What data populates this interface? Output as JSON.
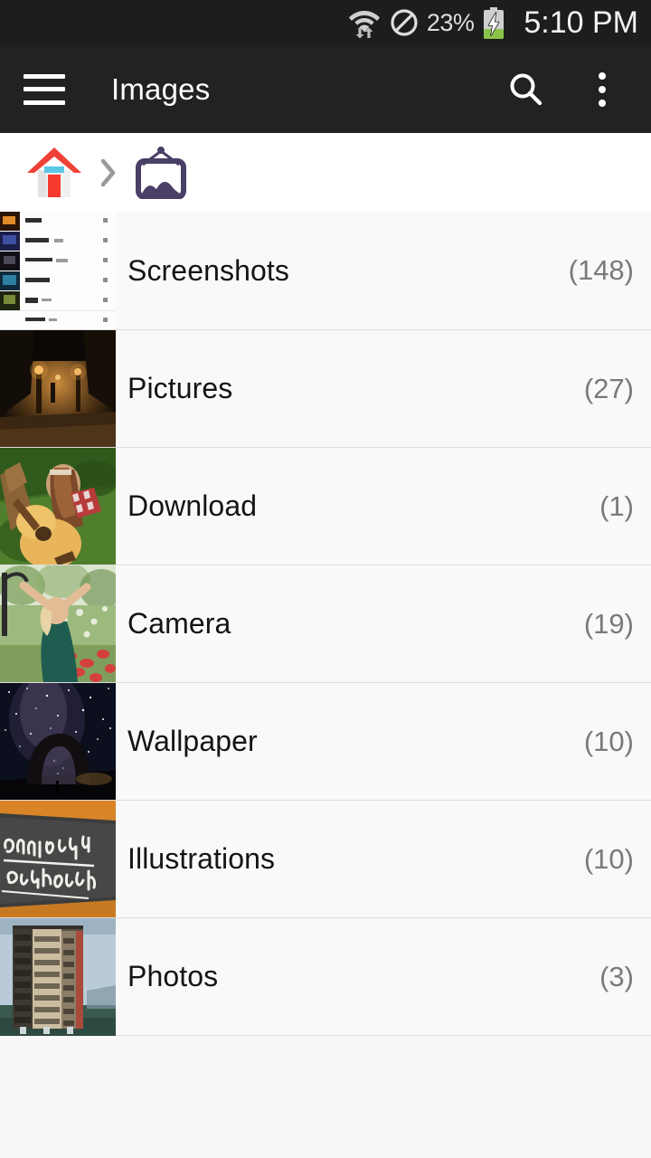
{
  "status_bar": {
    "wifi_icon": "wifi-with-data-arrows-icon",
    "block_icon": "do-not-disturb-icon",
    "battery_percent": "23%",
    "battery_icon": "battery-charging-icon",
    "time": "5:10 PM"
  },
  "app_bar": {
    "menu_icon": "hamburger-menu-icon",
    "title": "Images",
    "search_icon": "search-icon",
    "overflow_icon": "more-options-icon"
  },
  "breadcrumb": {
    "items": [
      {
        "name": "home-crumb",
        "icon": "home-icon"
      },
      {
        "name": "images-crumb",
        "icon": "picture-frame-icon"
      }
    ],
    "separator_icon": "chevron-right-icon"
  },
  "folders": [
    {
      "name": "Screenshots",
      "count": "(148)",
      "thumb": "screenshot-list-thumbnail"
    },
    {
      "name": "Pictures",
      "count": "(27)",
      "thumb": "night-street-thumbnail"
    },
    {
      "name": "Download",
      "count": "(1)",
      "thumb": "guitar-girl-thumbnail"
    },
    {
      "name": "Camera",
      "count": "(19)",
      "thumb": "woman-in-flower-field-thumbnail"
    },
    {
      "name": "Wallpaper",
      "count": "(10)",
      "thumb": "milky-way-arch-thumbnail"
    },
    {
      "name": "Illustrations",
      "count": "(10)",
      "thumb": "chalkboard-learning-thumbnail"
    },
    {
      "name": "Photos",
      "count": "(3)",
      "thumb": "apartment-building-thumbnail"
    }
  ],
  "colors": {
    "status_bar_bg": "#1d1d1d",
    "app_bar_bg": "#222222",
    "breadcrumb_bg": "#ffffff",
    "list_bg": "#f9f9f9",
    "page_bg": "#f8f8f8",
    "divider": "#dddddd",
    "title_text": "#ffffff",
    "folder_text": "#141414",
    "count_text": "#7a7a7a",
    "home_roof": "#ef4136",
    "home_window": "#5bc8e8",
    "frame_purple": "#4a3f66",
    "battery_green": "#8bc34a"
  }
}
